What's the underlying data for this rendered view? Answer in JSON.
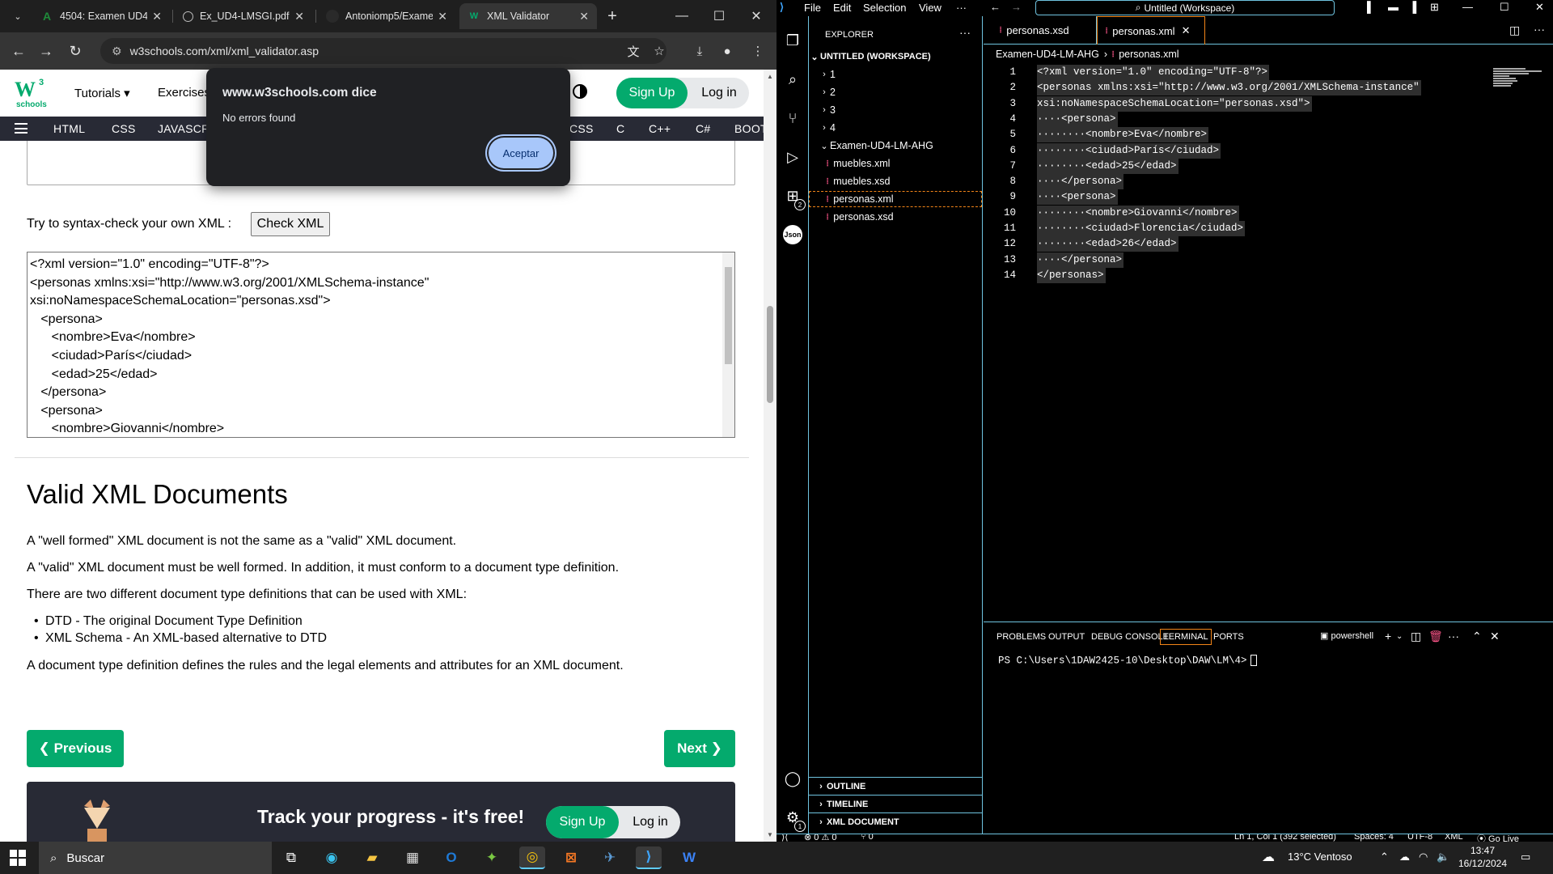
{
  "browser": {
    "tabs": [
      {
        "title": "4504: Examen UD4",
        "favicon": "A",
        "icon_color": "#1f8a3a"
      },
      {
        "title": "Ex_UD4-LMSGI.pdf",
        "favicon": "globe",
        "icon_color": "#aaaaaa"
      },
      {
        "title": "Antoniomp5/Exame",
        "favicon": "github",
        "icon_color": "#bbbbbb"
      },
      {
        "title": "XML Validator",
        "favicon": "w3",
        "icon_color": "#04aa6d"
      }
    ],
    "url": "w3schools.com/xml/xml_validator.asp",
    "new_tab": "+",
    "close_tab": "✕"
  },
  "w3": {
    "logo_w": "W",
    "logo_sup": "3",
    "logo_sub": "schools",
    "menu": [
      "Tutorials ▾",
      "Exercises"
    ],
    "signup": "Sign Up",
    "login": "Log in",
    "nav": [
      "HTML",
      "CSS",
      "JAVASCRI",
      "CSS",
      "C",
      "C++",
      "C#",
      "BOOT"
    ]
  },
  "dialog": {
    "title": "www.w3schools.com dice",
    "message": "No errors found",
    "ok": "Aceptar"
  },
  "page": {
    "try_label": "Try to syntax-check your own XML :",
    "check_button": "Check XML",
    "xml_lines": [
      "<?xml version=\"1.0\" encoding=\"UTF-8\"?>",
      "<personas xmlns:xsi=\"http://www.w3.org/2001/XMLSchema-instance\"",
      "xsi:noNamespaceSchemaLocation=\"personas.xsd\">",
      "   <persona>",
      "      <nombre>Eva</nombre>",
      "      <ciudad>París</ciudad>",
      "      <edad>25</edad>",
      "   </persona>",
      "   <persona>",
      "      <nombre>Giovanni</nombre>"
    ],
    "heading": "Valid XML Documents",
    "p1": "A \"well formed\" XML document is not the same as a \"valid\" XML document.",
    "p2": "A \"valid\" XML document must be well formed. In addition, it must conform to a document type definition.",
    "p3": "There are two different document type definitions that can be used with XML:",
    "bullets": [
      "DTD - The original Document Type Definition",
      "XML Schema - An XML-based alternative to DTD"
    ],
    "p4": "A document type definition defines the rules and the legal elements and attributes for an XML document.",
    "prev": "❮ Previous",
    "next": "Next ❯",
    "track_title": "Track your progress - it's free!",
    "track_signup": "Sign Up",
    "track_login": "Log in"
  },
  "vscode": {
    "menu": [
      "File",
      "Edit",
      "Selection",
      "View",
      "···"
    ],
    "search": "Untitled (Workspace)",
    "explorer_title": "EXPLORER",
    "workspace": "UNTITLED (WORKSPACE)",
    "folders": [
      "1",
      "2",
      "3",
      "4"
    ],
    "open_folder": "Examen-UD4-LM-AHG",
    "files": [
      "muebles.xml",
      "muebles.xsd",
      "personas.xml",
      "personas.xsd"
    ],
    "sections": [
      "OUTLINE",
      "TIMELINE",
      "XML DOCUMENT"
    ],
    "tabs": [
      "personas.xsd",
      "personas.xml"
    ],
    "breadcrumb": [
      "Examen-UD4-LM-AHG",
      "personas.xml"
    ],
    "code": [
      "<?xml version=\"1.0\" encoding=\"UTF-8\"?>",
      "<personas xmlns:xsi=\"http://www.w3.org/2001/XMLSchema-instance\"",
      "xsi:noNamespaceSchemaLocation=\"personas.xsd\">",
      "····<persona>",
      "········<nombre>Eva</nombre>",
      "········<ciudad>París</ciudad>",
      "········<edad>25</edad>",
      "····</persona>",
      "····<persona>",
      "········<nombre>Giovanni</nombre>",
      "········<ciudad>Florencia</ciudad>",
      "········<edad>26</edad>",
      "····</persona>",
      "</personas>"
    ],
    "panel_tabs": [
      "PROBLEMS",
      "OUTPUT",
      "DEBUG CONSOLE",
      "TERMINAL",
      "PORTS"
    ],
    "shell": "powershell",
    "prompt": "PS C:\\Users\\1DAW2425-10\\Desktop\\DAW\\LM\\4>",
    "status": {
      "errors": "⊗ 0 ⚠ 0",
      "ports": "⑂ 0",
      "position": "Ln 1, Col 1 (392 selected)",
      "spaces": "Spaces: 4",
      "encoding": "UTF-8",
      "language": "XML",
      "golive": "⦿ Go Live"
    }
  },
  "taskbar": {
    "search": "Buscar",
    "weather": "13°C  Ventoso",
    "time": "13:47",
    "date": "16/12/2024"
  }
}
